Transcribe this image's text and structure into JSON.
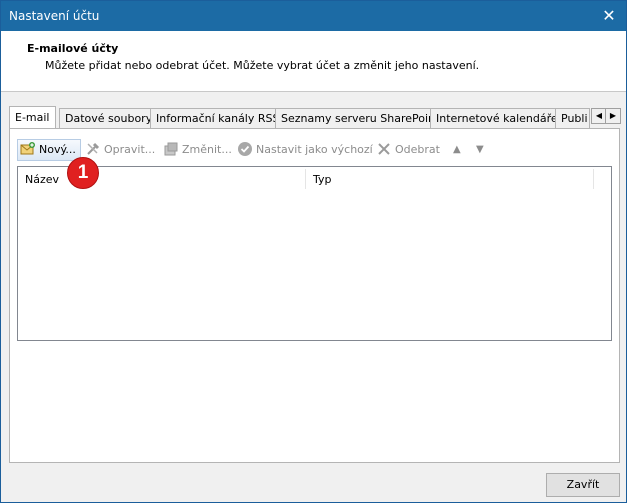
{
  "window": {
    "title": "Nastavení účtu",
    "close_glyph": "✕"
  },
  "header": {
    "heading": "E-mailové účty",
    "description": "Můžete přidat nebo odebrat účet. Můžete vybrat účet a změnit jeho nastavení."
  },
  "tabs": [
    {
      "label": "E-mail",
      "active": true
    },
    {
      "label": "Datové soubory"
    },
    {
      "label": "Informační kanály RSS"
    },
    {
      "label": "Seznamy serveru SharePoint"
    },
    {
      "label": "Internetové kalendáře"
    },
    {
      "label": "Publi"
    }
  ],
  "tab_scroll": {
    "left": "◀",
    "right": "▶"
  },
  "toolbar": {
    "new": "Nový...",
    "repair": "Opravit...",
    "change": "Změnit...",
    "set_default": "Nastavit jako výchozí",
    "remove": "Odebrat",
    "move_up": "▲",
    "move_down": "▼"
  },
  "list": {
    "columns": [
      "Název",
      "Typ"
    ],
    "rows": []
  },
  "callout": {
    "number": "1"
  },
  "footer": {
    "close": "Zavřít"
  },
  "colors": {
    "titlebar": "#1c6ba5",
    "callout": "#e02020"
  }
}
